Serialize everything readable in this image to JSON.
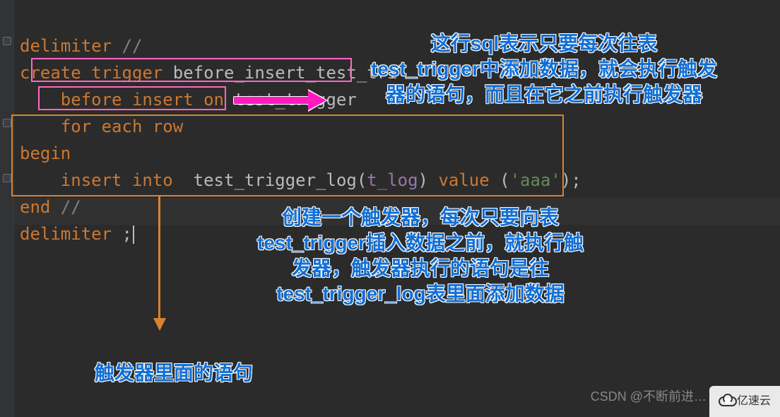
{
  "code": {
    "l1": {
      "kw": "delimiter",
      "rest": " //"
    },
    "l2": {
      "a": "create trigger",
      "b": " before_insert_test_tri"
    },
    "l3": {
      "indent": "    ",
      "a": "before insert on",
      "b": " test_trigger"
    },
    "l4": {
      "indent": "    ",
      "a": "for each row"
    },
    "l5": {
      "a": "begin"
    },
    "l6": {
      "indent": "    ",
      "a": "insert into",
      "sp": "  ",
      "b": "test_trigger_log(",
      "col": "t_log",
      "c": ") ",
      "d": "value",
      "e": " (",
      "str": "'aaa'",
      "f": ");"
    },
    "l7": {
      "a": "end",
      "rest": " //"
    },
    "l8": {
      "kw": "delimiter",
      "rest": " ;"
    }
  },
  "annotations": {
    "a1_part1": "这行",
    "a1_sql": "sql",
    "a1_part2": "表示只要每次往表",
    "a1_line2a": "test_trigger",
    "a1_line2b": "中添加数据，就会执行触发器的语句，而且在它之前执行触发器",
    "a2_part1": "创建一个触发器，每次只要向表",
    "a2_tt": "test_trigger",
    "a2_part2": "插入数据之前，就执行触发器，触发器执行的语句是往",
    "a2_log": "test_trigger_log",
    "a2_part3": "表里面添加数据",
    "a3": "触发器里面的语句"
  },
  "watermarks": {
    "csdn": "CSDN @不断前进…",
    "yisu": "亿速云"
  }
}
